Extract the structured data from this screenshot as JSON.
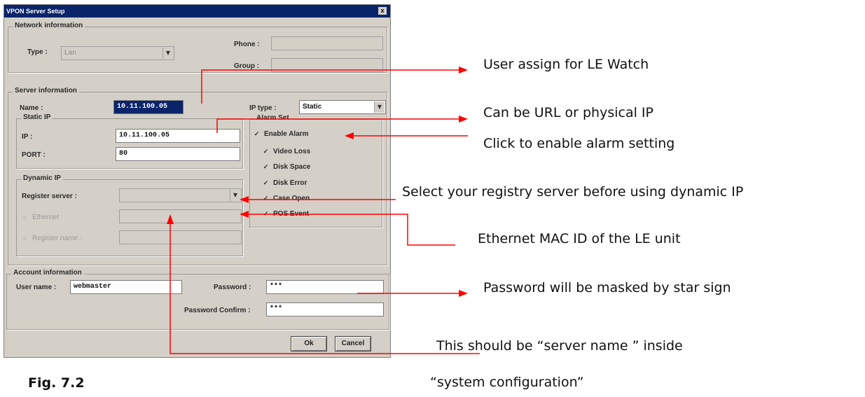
{
  "dialog": {
    "title": "VPON Server Setup",
    "close_label": "x",
    "network": {
      "group_title": "Network information",
      "type_label": "Type :",
      "type_value": "Lan",
      "phone_label": "Phone :",
      "group_label": "Group :"
    },
    "server": {
      "group_title": "Server information",
      "name_label": "Name :",
      "name_value": "10.11.100.05",
      "ip_type_label": "IP type :",
      "ip_type_value": "Static",
      "static_ip": {
        "group_title": "Static IP",
        "ip_label": "IP :",
        "ip_value": "10.11.100.05",
        "port_label": "PORT :",
        "port_value": "80"
      },
      "dynamic_ip": {
        "group_title": "Dynamic IP",
        "register_server_label": "Register server :",
        "ethernet_option": "Ethernet",
        "register_name_option": "Register name :"
      },
      "alarm_set": {
        "group_title": "Alarm Set",
        "enable_alarm": "Enable Alarm",
        "items": [
          "Video Loss",
          "Disk Space",
          "Disk Error",
          "Case Open",
          "POS Event"
        ]
      }
    },
    "account": {
      "group_title": "Account information",
      "username_label": "User name :",
      "username_value": "webmaster",
      "password_label": "Password :",
      "password_value": "***",
      "password_confirm_label": "Password Confirm :",
      "password_confirm_value": "***"
    },
    "ok_label": "Ok",
    "cancel_label": "Cancel"
  },
  "annotations": {
    "user_assign": "User assign for LE Watch",
    "url_or_ip": "Can be URL or physical IP",
    "enable_alarm": "Click to enable alarm setting",
    "registry_server": "Select your registry server before using dynamic IP",
    "mac_id": "Ethernet MAC ID of the LE unit",
    "password_masked": "Password will be masked by star sign",
    "server_name_line1": "This should be “server name ” inside",
    "server_name_line2": "“system configuration”"
  },
  "figure_caption": "Fig. 7.2",
  "colors": {
    "arrow": "#ff0000",
    "titlebar": "#0a246a",
    "dialog_bg": "#d4d0c8"
  }
}
